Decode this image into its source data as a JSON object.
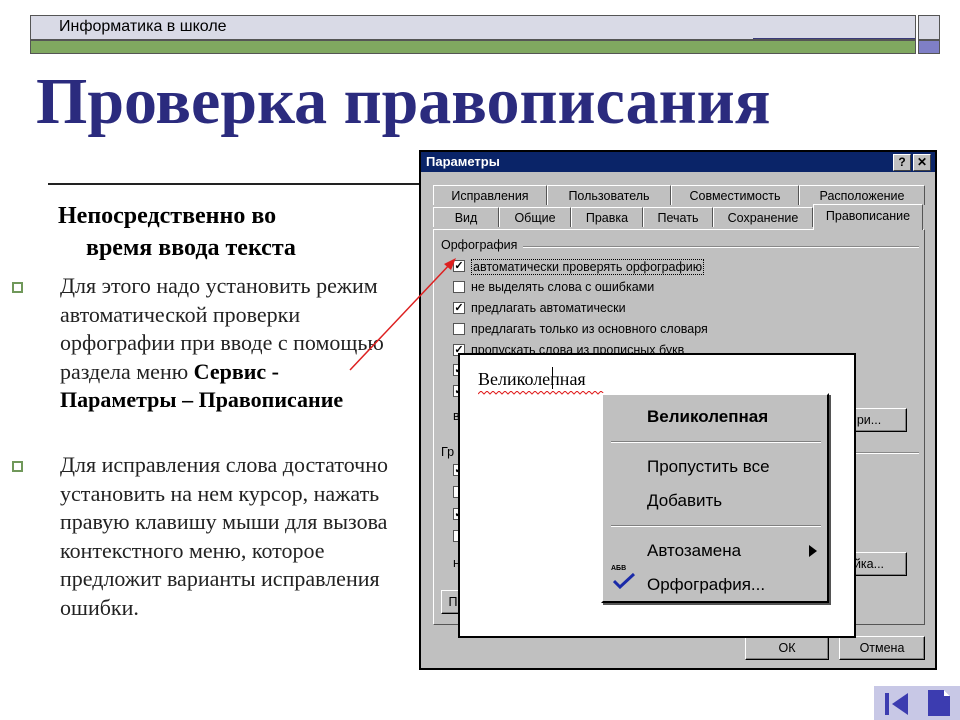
{
  "header": {
    "text": "Информатика в школе"
  },
  "title": "Проверка правописания",
  "subtitle_line1": "Непосредственно во",
  "subtitle_line2": "время ввода текста",
  "bullets": [
    {
      "text1": "Для этого надо установить режим автоматической проверки орфографии при вводе с помощью раздела меню ",
      "bold": "Сервис - Параметры – Правописание"
    },
    {
      "text1": "Для исправления слова достаточно установить на нем курсор, нажать правую клавишу мыши для вызова контекстного меню, которое предложит варианты исправления ошибки."
    }
  ],
  "dialog": {
    "title": "Параметры",
    "help_btn": "?",
    "close_btn": "✕",
    "tabs_row1": [
      "Исправления",
      "Пользователь",
      "Совместимость",
      "Расположение"
    ],
    "tabs_row2": [
      "Вид",
      "Общие",
      "Правка",
      "Печать",
      "Сохранение",
      "Правописание"
    ],
    "group_spelling": "Орфография",
    "options": [
      {
        "label": "автоматически проверять орфографию",
        "checked": true
      },
      {
        "label": "не выделять слова с ошибками",
        "checked": false
      },
      {
        "label": "предлагать автоматически",
        "checked": true
      },
      {
        "label": "предлагать только из основного словаря",
        "checked": false
      },
      {
        "label": "пропускать слова из прописных букв",
        "checked": true
      }
    ],
    "stub_btn1": "ри...",
    "stub_btn2": "йка...",
    "group_grammar_stub": "Гр",
    "stub_v": "в",
    "stub_n": "н",
    "stub_p": "П",
    "ok": "ОК",
    "cancel": "Отмена"
  },
  "popup": {
    "word": "Великолепная",
    "menu": {
      "suggestion": "Великолепная",
      "skip_all": "Пропустить все",
      "add": "Добавить",
      "autocorrect": "Автозамена",
      "spelling": "Орфография...",
      "spelling_icon_text": "АБВ"
    }
  },
  "colors": {
    "title": "#2b2b7e",
    "bar": "#80a860",
    "arrow": "#dd2020",
    "dialog_title": "#0a2468"
  },
  "icons": {
    "nav_prev": "first-page-icon",
    "nav_next": "document-icon",
    "spelling": "spellcheck-icon",
    "submenu": "triangle-right-icon"
  }
}
